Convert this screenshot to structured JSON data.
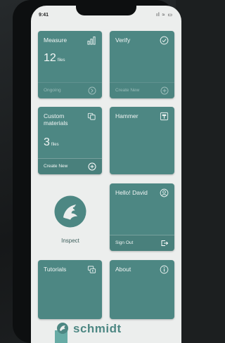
{
  "status_bar": {
    "time": "9:41",
    "icons": "ıl ≈ ▭"
  },
  "tiles": {
    "measure": {
      "title": "Measure",
      "value": "12",
      "unit": "files",
      "icon": "chart-icon",
      "footer": "Ongoing"
    },
    "verify": {
      "title": "Verify",
      "icon": "check-circle-icon",
      "footer": "Create New"
    },
    "custom_materials": {
      "title": "Custom materials",
      "value": "3",
      "unit": "files",
      "icon": "layers-icon",
      "footer": "Create New"
    },
    "hammer": {
      "title": "Hammer",
      "icon": "hammer-box-icon"
    },
    "profile": {
      "title": "Hello! David",
      "icon": "user-icon",
      "footer": "Sign Out"
    },
    "tutorials": {
      "title": "Tutorials",
      "icon": "tutorials-icon"
    },
    "about": {
      "title": "About",
      "icon": "info-icon"
    }
  },
  "inspect": {
    "label": "Inspect",
    "icon": "eagle-logo-icon"
  },
  "brand": {
    "name": "schmidt",
    "icon": "schmidt-logo-icon"
  },
  "colors": {
    "tile": "#4d8783",
    "screen_bg": "#eceeed",
    "brand": "#4d8783"
  }
}
